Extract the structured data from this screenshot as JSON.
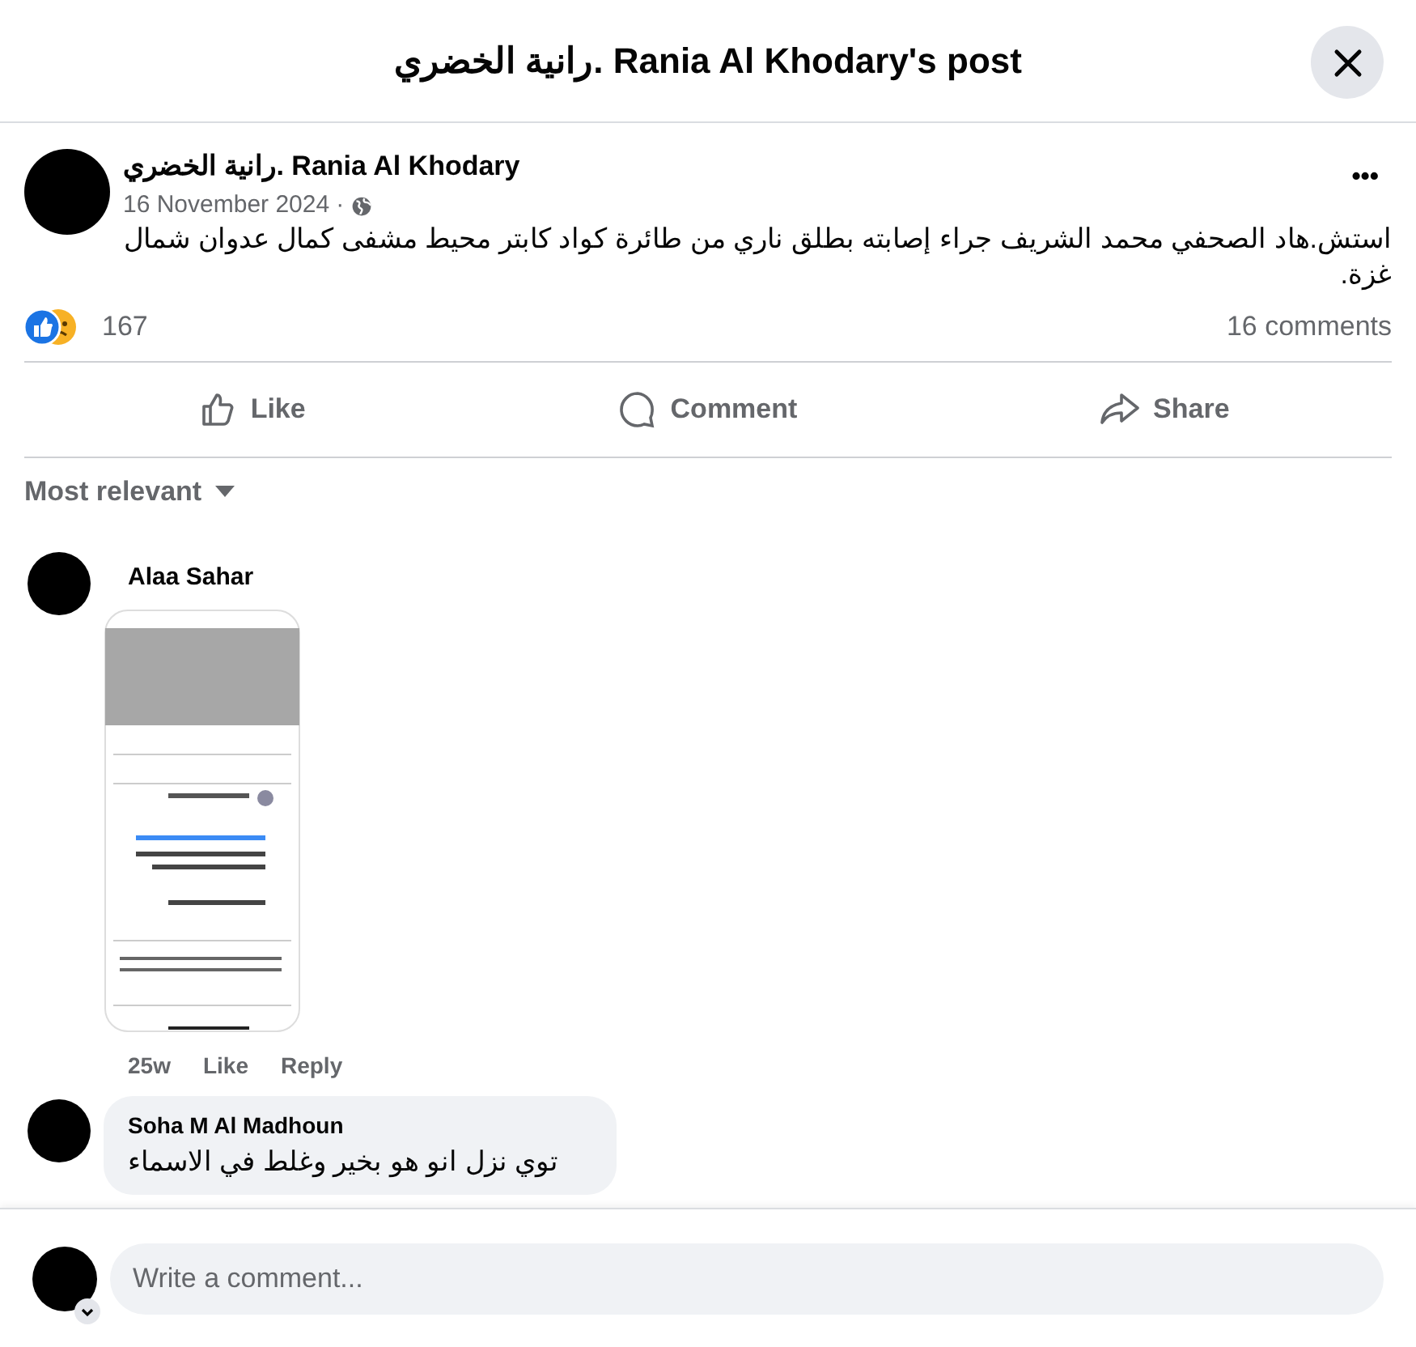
{
  "header": {
    "title": "رانية الخضري. Rania Al Khodary's post"
  },
  "post": {
    "author": "رانية الخضري. Rania Al Khodary",
    "date": "16 November 2024",
    "separator": "·",
    "more": "•••",
    "text": "استش.هاد الصحفي محمد الشريف جراء إصابته بطلق ناري من طائرة كواد كابتر محيط مشفى كمال عدوان شمال غزة.",
    "reaction_count": "167",
    "comments_count": "16 comments"
  },
  "actions": [
    {
      "kind": "like",
      "label": "Like"
    },
    {
      "kind": "comment",
      "label": "Comment"
    },
    {
      "kind": "share",
      "label": "Share"
    }
  ],
  "sort": {
    "label": "Most relevant"
  },
  "comments": [
    {
      "kind": "image",
      "author": "Alaa Sahar",
      "time": "25w",
      "like": "Like",
      "reply": "Reply"
    },
    {
      "kind": "text",
      "author": "Soha M Al Madhoun",
      "text": "توي نزل انو هو بخير وغلط في الاسماء"
    }
  ],
  "composer": {
    "placeholder": "Write a comment..."
  }
}
